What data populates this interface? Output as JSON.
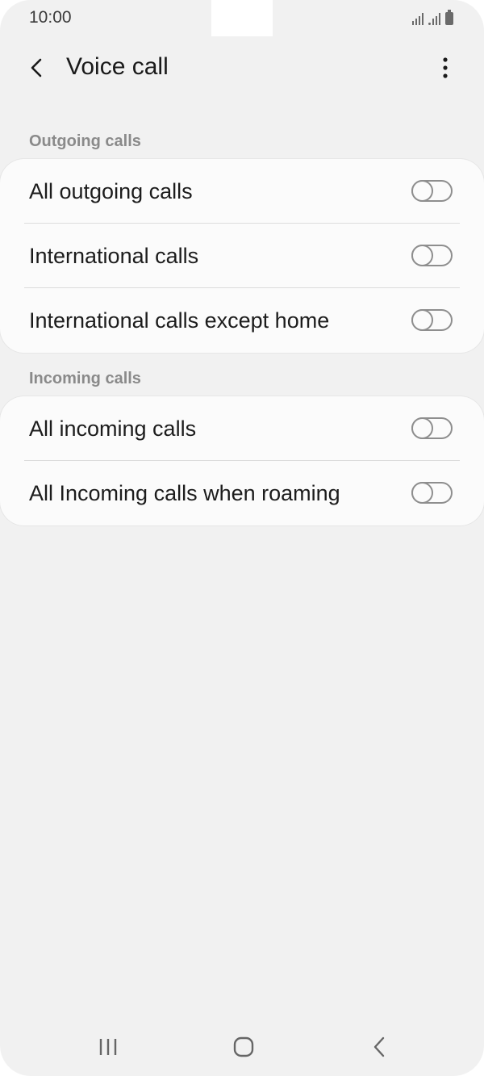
{
  "status_bar": {
    "time": "10:00"
  },
  "app_bar": {
    "title": "Voice call",
    "back_icon": "chevron-left-icon",
    "more_icon": "more-vert-icon"
  },
  "sections": [
    {
      "header": "Outgoing calls",
      "items": [
        {
          "label": "All outgoing calls",
          "enabled": false
        },
        {
          "label": "International calls",
          "enabled": false
        },
        {
          "label": "International calls except home",
          "enabled": false
        }
      ]
    },
    {
      "header": "Incoming calls",
      "items": [
        {
          "label": "All incoming calls",
          "enabled": false
        },
        {
          "label": "All Incoming calls when roaming",
          "enabled": false
        }
      ]
    }
  ],
  "nav_bar": {
    "recents_icon": "recents-icon",
    "home_icon": "home-icon",
    "back_icon": "back-icon"
  },
  "colors": {
    "background": "#f1f1f1",
    "card": "#fbfbfb",
    "section_header": "#8a8a8a",
    "toggle_off": "#8e8e8e"
  }
}
